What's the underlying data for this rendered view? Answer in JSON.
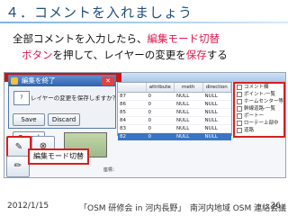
{
  "slide": {
    "title": "４．コメントを入れましょう",
    "body_line1_part1": "全部コメントを入力したら、",
    "body_line1_red": "編集モード切替",
    "body_line2_red1": "ボタン",
    "body_line2_part2": "を押して、レイヤーの変更を",
    "body_line2_red2": "保存",
    "body_line2_part3": "する"
  },
  "dialog": {
    "title": "編集を終了",
    "message": "レイヤーの変更を保存しますか？",
    "buttons": [
      "Save",
      "Discard",
      "Cancel"
    ]
  },
  "grid": {
    "columns": [
      "",
      "attribute",
      "meth",
      "direction"
    ],
    "rows": [
      [
        "87",
        "0",
        "NULL",
        "NULL"
      ],
      [
        "86",
        "0",
        "NULL",
        "NULL"
      ],
      [
        "85",
        "0",
        "NULL",
        "NULL"
      ],
      [
        "84",
        "0",
        "NULL",
        "NULL"
      ],
      [
        "83",
        "0",
        "NULL",
        "NULL"
      ],
      [
        "82",
        "0",
        "NULL",
        "NULL"
      ]
    ]
  },
  "layers": [
    "コメント欄",
    "ポイント-一覧",
    "ホームセンター等",
    "幹線道路-一覧",
    "ポートー",
    "ローテー上部中",
    "道路",
    "トー"
  ],
  "edit_mode_label": "編集モード切替",
  "status_text": "座標：",
  "footer": {
    "date": "2012/1/15",
    "center": "「OSM 研修会 in 河内長野」　南河内地域 OSM 連絡会議",
    "page": "36"
  },
  "colors": {
    "accent_red": "#e0174f",
    "title_blue": "#1f4e79",
    "highlight_border": "#d61f1f"
  }
}
